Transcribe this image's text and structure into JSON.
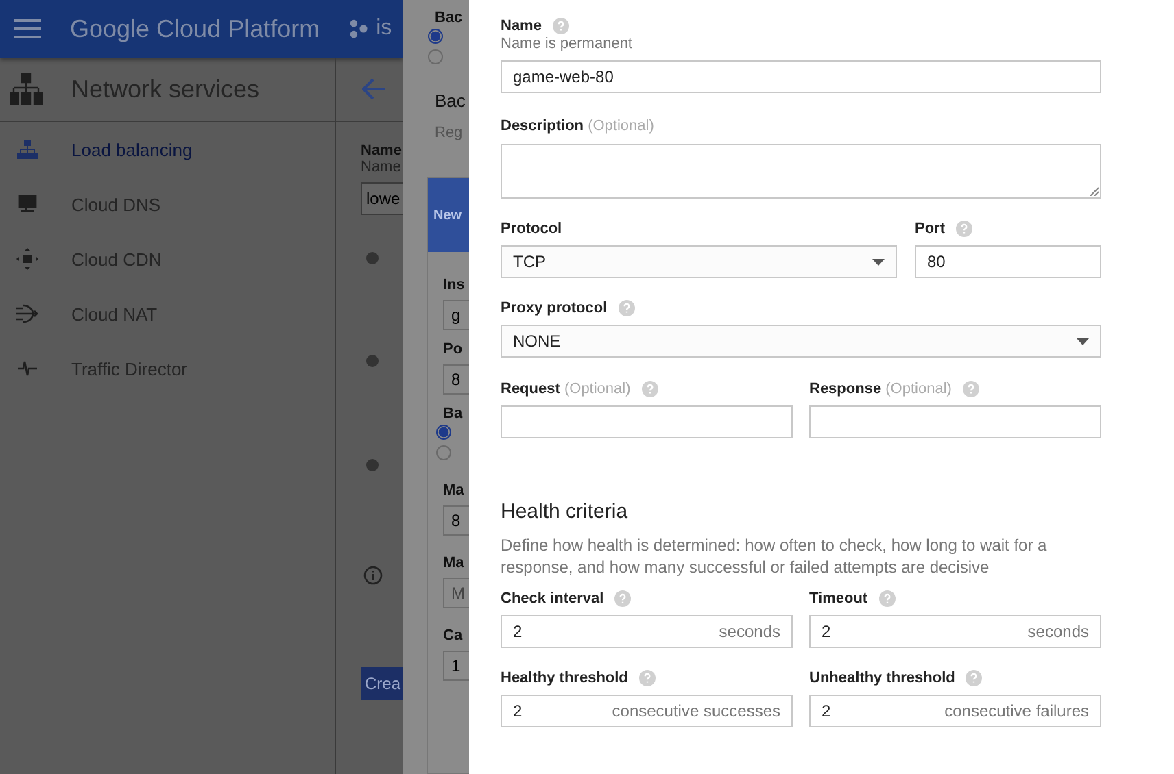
{
  "header": {
    "title": "Google Cloud Platform",
    "project": "is"
  },
  "sidebar": {
    "title": "Network services",
    "items": [
      {
        "label": "Load balancing",
        "selected": true
      },
      {
        "label": "Cloud DNS",
        "selected": false
      },
      {
        "label": "Cloud CDN",
        "selected": false
      },
      {
        "label": "Cloud NAT",
        "selected": false
      },
      {
        "label": "Traffic Director",
        "selected": false
      }
    ]
  },
  "background_page": {
    "name_label": "Name",
    "name_hint": "Name",
    "name_value": "lowe",
    "create_button": "Crea"
  },
  "background_dialog": {
    "type_label": "Bac",
    "type_options": [
      {
        "selected": true
      },
      {
        "selected": false
      }
    ],
    "section_title": "Bac",
    "region_hint": "Reg",
    "card_title": "New",
    "fields": [
      {
        "label": "Ins",
        "value": "g"
      },
      {
        "label": "Po",
        "value": "8"
      }
    ],
    "mode_label": "Ba",
    "mode_options": [
      {
        "selected": true
      },
      {
        "selected": false
      }
    ],
    "fields_2": [
      {
        "label": "Ma",
        "value": "8",
        "kind": "value"
      },
      {
        "label": "Ma",
        "placeholder": "M",
        "kind": "placeholder"
      },
      {
        "label": "Ca",
        "value": "1",
        "kind": "value"
      }
    ]
  },
  "form": {
    "name": {
      "label": "Name",
      "hint": "Name is permanent",
      "value": "game-web-80"
    },
    "description": {
      "label": "Description",
      "optional": "(Optional)"
    },
    "protocol": {
      "label": "Protocol",
      "value": "TCP"
    },
    "port": {
      "label": "Port",
      "value": "80"
    },
    "proxy_protocol": {
      "label": "Proxy protocol",
      "value": "NONE"
    },
    "request": {
      "label": "Request",
      "optional": "(Optional)"
    },
    "response": {
      "label": "Response",
      "optional": "(Optional)"
    },
    "health": {
      "title": "Health criteria",
      "description": "Define how health is determined: how often to check, how long to wait for a response, and how many successful or failed attempts are decisive",
      "fields": [
        {
          "label": "Check interval",
          "value": "2",
          "unit": "seconds"
        },
        {
          "label": "Timeout",
          "value": "2",
          "unit": "seconds"
        },
        {
          "label": "Healthy threshold",
          "value": "2",
          "unit": "consecutive successes"
        },
        {
          "label": "Unhealthy threshold",
          "value": "2",
          "unit": "consecutive failures"
        }
      ]
    }
  }
}
